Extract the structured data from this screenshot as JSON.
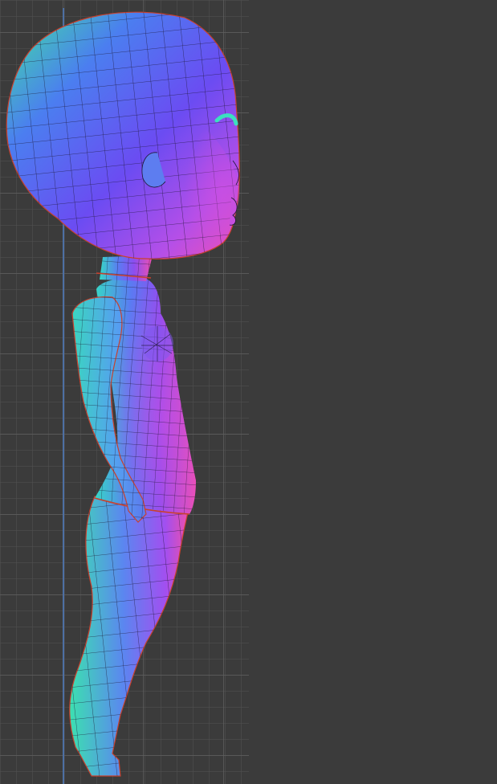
{
  "viewport": {
    "background": "#3b3b3b",
    "grid_color": "#505050",
    "axis_color": "#4d6fa3",
    "shading": "normal-map",
    "figures": [
      {
        "id": "left",
        "facing": "right",
        "seam_color": "#c8412e"
      },
      {
        "id": "right",
        "facing": "left",
        "seam_color": "#c8412e"
      }
    ]
  }
}
